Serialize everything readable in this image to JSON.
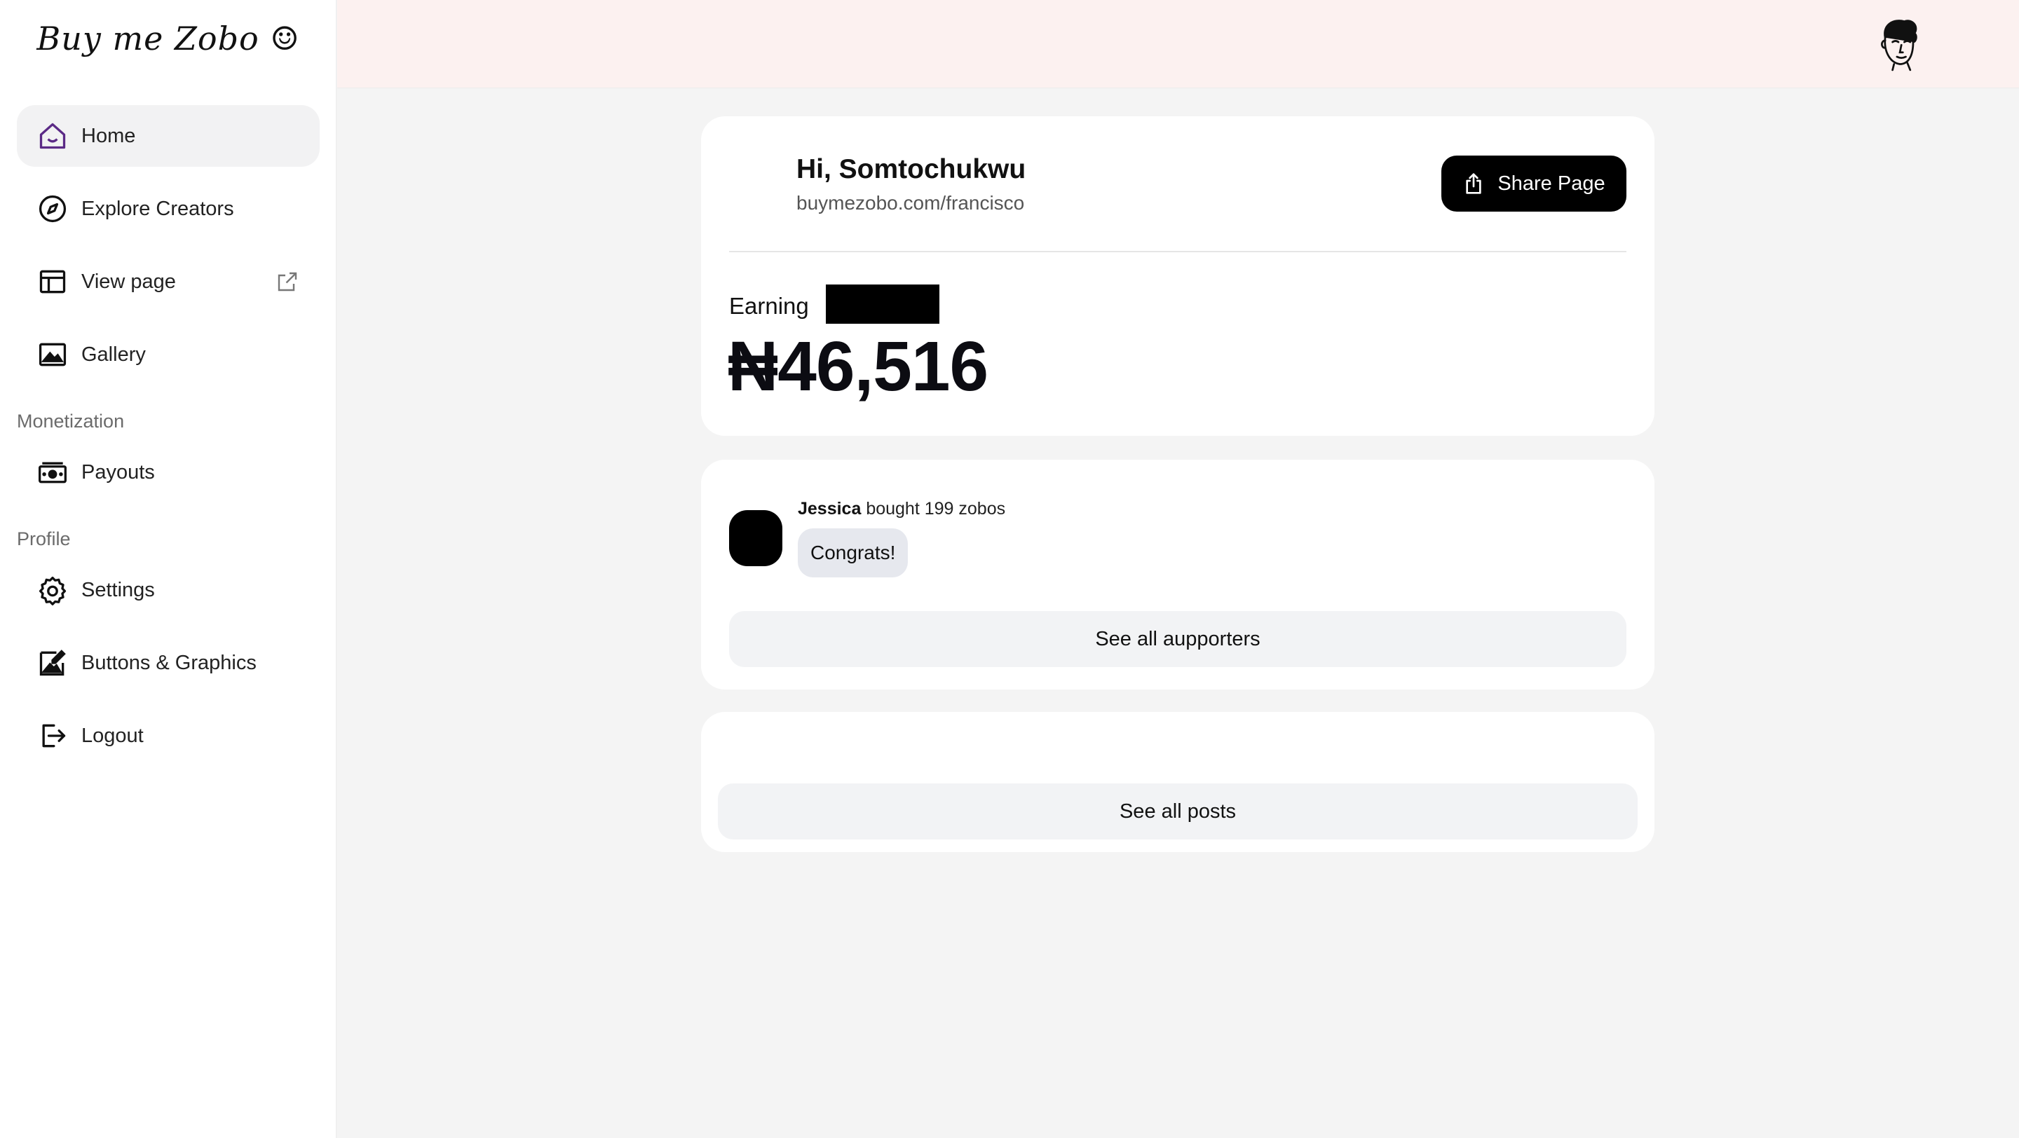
{
  "sidebar": {
    "logo": "Buy me Zobo ☺",
    "items": [
      {
        "label": "Home",
        "icon": "home-icon"
      },
      {
        "label": "Explore Creators",
        "icon": "compass-icon"
      },
      {
        "label": "View page",
        "icon": "layout-icon"
      },
      {
        "label": "Gallery",
        "icon": "image-icon"
      },
      {
        "label": "Payouts",
        "icon": "money-icon"
      },
      {
        "label": "Settings",
        "icon": "gear-icon"
      },
      {
        "label": "Buttons & Graphics",
        "icon": "graphics-icon"
      },
      {
        "label": "Logout",
        "icon": "logout-icon"
      }
    ],
    "sections": {
      "monetization": "Monetization",
      "profile": "Profile"
    }
  },
  "header": {
    "avatar_icon": "user-avatar-icon"
  },
  "summary": {
    "greeting": "Hi, Somtochukwu",
    "page_url": "buymezobo.com/francisco",
    "share_label": "Share Page",
    "earning_label": "Earning",
    "amount": "₦46,516"
  },
  "supporters": {
    "name": "Jessica",
    "action": " bought 199 zobos",
    "message": "Congrats!",
    "see_all_label": "See all aupporters"
  },
  "posts": {
    "see_all_label": "See all posts"
  },
  "colors": {
    "accent": "#5b2a86",
    "header_bg": "#fcf1f0",
    "page_bg": "#f4f4f4",
    "button_dark": "#000000"
  }
}
